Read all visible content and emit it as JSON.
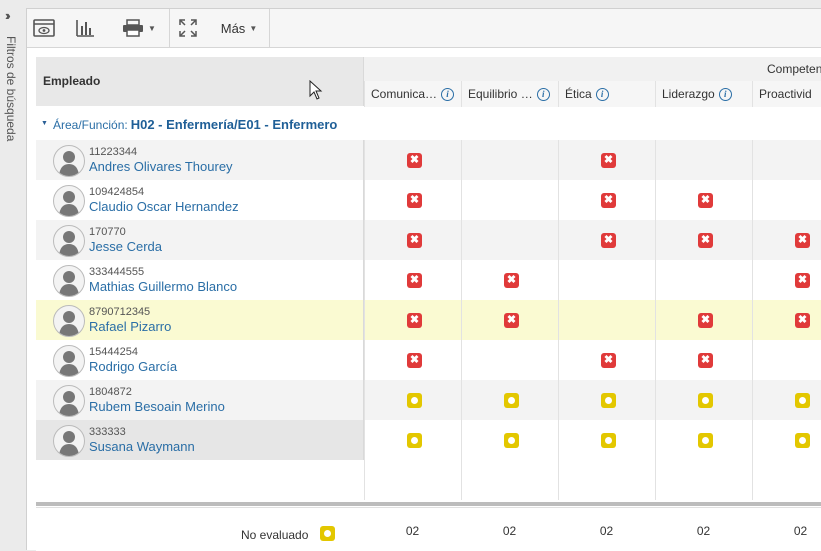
{
  "sidebar": {
    "collapse_icon": "double-chevron-right-icon",
    "label": "Filtros de búsqueda"
  },
  "toolbar": {
    "mas_label": "Más"
  },
  "grid": {
    "employee_header": "Empleado",
    "group_label": "Área/Función:",
    "group_value": "H02 - Enfermería/E01 - Enfermero",
    "competencies_label": "Competen",
    "columns": [
      "Comunica…",
      "Equilibrio …",
      "Ética",
      "Liderazgo",
      "Proactivid"
    ],
    "rows": [
      {
        "id": "11223344",
        "name": "Andres Olivares Thourey",
        "marks": [
          "x",
          "",
          "x",
          "",
          ""
        ]
      },
      {
        "id": "109424854",
        "name": "Claudio Oscar Hernandez",
        "marks": [
          "x",
          "",
          "x",
          "x",
          ""
        ]
      },
      {
        "id": "170770",
        "name": "Jesse Cerda",
        "marks": [
          "x",
          "",
          "x",
          "x",
          "x"
        ]
      },
      {
        "id": "333444555",
        "name": "Mathias Guillermo Blanco",
        "marks": [
          "x",
          "x",
          "",
          "",
          "x"
        ]
      },
      {
        "id": "8790712345",
        "name": "Rafael Pizarro",
        "marks": [
          "x",
          "x",
          "",
          "x",
          "x"
        ]
      },
      {
        "id": "15444254",
        "name": "Rodrigo García",
        "marks": [
          "x",
          "",
          "x",
          "x",
          ""
        ]
      },
      {
        "id": "1804872",
        "name": "Rubem Besoain Merino",
        "marks": [
          "o",
          "o",
          "o",
          "o",
          "o"
        ]
      },
      {
        "id": "333333",
        "name": "Susana Waymann",
        "marks": [
          "o",
          "o",
          "o",
          "o",
          "o"
        ]
      }
    ],
    "footer": {
      "label": "No evaluado",
      "values": [
        "02",
        "02",
        "02",
        "02",
        "02"
      ]
    }
  },
  "colors": {
    "x_mark": "#e03a3a",
    "o_mark": "#e3c700",
    "highlight_row": "#fafad2",
    "link": "#2a6ea6"
  }
}
